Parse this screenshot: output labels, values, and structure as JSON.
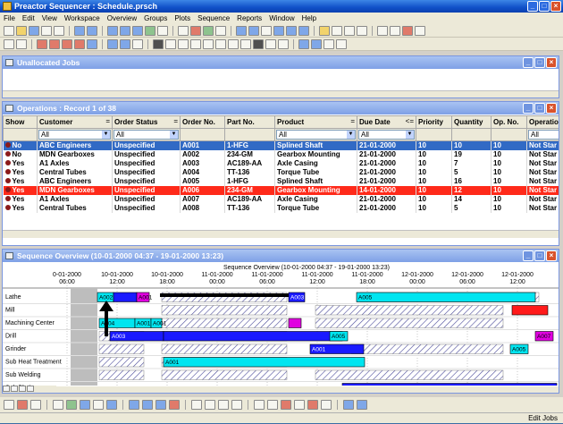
{
  "window": {
    "title": "Preactor Sequencer : Schedule.prsch"
  },
  "menu": [
    "File",
    "Edit",
    "View",
    "Workspace",
    "Overview",
    "Groups",
    "Plots",
    "Sequence",
    "Reports",
    "Window",
    "Help"
  ],
  "unallocated": {
    "title": "Unallocated Jobs"
  },
  "operations": {
    "title": "Operations : Record 1 of 38",
    "columns": [
      "Show",
      "Customer",
      "Order Status",
      "Order No.",
      "Part No.",
      "Product",
      "Due Date",
      "Priority",
      "Quantity",
      "Op. No.",
      "Operatio"
    ],
    "column_flags": {
      "customer": "=",
      "order_status": "=",
      "product": "=",
      "due_date": "<="
    },
    "filters": {
      "customer": "All",
      "order_status": "All",
      "product": "All",
      "due_date": "All",
      "operation": "All"
    },
    "rows": [
      {
        "show": "No",
        "customer": "ABC Engineers",
        "status": "Unspecified",
        "order": "A001",
        "part": "1-HFG",
        "product": "Splined Shaft",
        "due": "21-01-2000",
        "priority": "10",
        "qty": "10",
        "op": "10",
        "operation": "Not Star",
        "style": "selected"
      },
      {
        "show": "No",
        "customer": "MDN Gearboxes",
        "status": "Unspecified",
        "order": "A002",
        "part": "234-GM",
        "product": "Gearbox Mounting",
        "due": "21-01-2000",
        "priority": "10",
        "qty": "19",
        "op": "10",
        "operation": "Not Star",
        "style": ""
      },
      {
        "show": "Yes",
        "customer": "A1 Axles",
        "status": "Unspecified",
        "order": "A003",
        "part": "AC189-AA",
        "product": "Axle Casing",
        "due": "21-01-2000",
        "priority": "10",
        "qty": "7",
        "op": "10",
        "operation": "Not Star",
        "style": ""
      },
      {
        "show": "Yes",
        "customer": "Central Tubes",
        "status": "Unspecified",
        "order": "A004",
        "part": "TT-136",
        "product": "Torque Tube",
        "due": "21-01-2000",
        "priority": "10",
        "qty": "5",
        "op": "10",
        "operation": "Not Star",
        "style": ""
      },
      {
        "show": "Yes",
        "customer": "ABC Engineers",
        "status": "Unspecified",
        "order": "A005",
        "part": "1-HFG",
        "product": "Splined Shaft",
        "due": "21-01-2000",
        "priority": "10",
        "qty": "16",
        "op": "10",
        "operation": "Not Star",
        "style": ""
      },
      {
        "show": "Yes",
        "customer": "MDN Gearboxes",
        "status": "Unspecified",
        "order": "A006",
        "part": "234-GM",
        "product": "Gearbox Mounting",
        "due": "14-01-2000",
        "priority": "10",
        "qty": "12",
        "op": "10",
        "operation": "Not Star",
        "style": "late"
      },
      {
        "show": "Yes",
        "customer": "A1 Axles",
        "status": "Unspecified",
        "order": "A007",
        "part": "AC189-AA",
        "product": "Axle Casing",
        "due": "21-01-2000",
        "priority": "10",
        "qty": "14",
        "op": "10",
        "operation": "Not Star",
        "style": ""
      },
      {
        "show": "Yes",
        "customer": "Central Tubes",
        "status": "Unspecified",
        "order": "A008",
        "part": "TT-136",
        "product": "Torque Tube",
        "due": "21-01-2000",
        "priority": "10",
        "qty": "5",
        "op": "10",
        "operation": "Not Star",
        "style": ""
      }
    ]
  },
  "sequence": {
    "title": "Sequence Overview   (10-01-2000 04:37 - 19-01-2000 13:23)",
    "header": "Sequence Overview   (10-01-2000 04:37 - 19-01-2000 13:23)",
    "timeline": [
      {
        "date": "0-01-2000",
        "time": "06:00"
      },
      {
        "date": "10-01-2000",
        "time": "12:00"
      },
      {
        "date": "10-01-2000",
        "time": "18:00"
      },
      {
        "date": "11-01-2000",
        "time": "00:00"
      },
      {
        "date": "11-01-2000",
        "time": "06:00"
      },
      {
        "date": "11-01-2000",
        "time": "12:00"
      },
      {
        "date": "11-01-2000",
        "time": "18:00"
      },
      {
        "date": "12-01-2000",
        "time": "00:00"
      },
      {
        "date": "12-01-2000",
        "time": "06:00"
      },
      {
        "date": "12-01-2000",
        "time": "12:00"
      }
    ],
    "resources": [
      "Lathe",
      "Mill",
      "Machining Center",
      "Drill",
      "Grinder",
      "Sub Heat Treatment",
      "Sub Welding",
      "Sub Plating"
    ],
    "colors": {
      "cyan": "#00e5f0",
      "blue": "#1a1aff",
      "magenta": "#e000e0",
      "red": "#ff1a1a",
      "hatch": "#4a4a9a"
    },
    "jobs": {
      "lathe": [
        "A002",
        "A001",
        "A003",
        "A006",
        "A005"
      ],
      "machining": [
        "A004",
        "A001",
        "A001",
        "A003"
      ],
      "drill": [
        "A003",
        "A005",
        "A007"
      ],
      "grinder": [
        "A001",
        "A005"
      ],
      "heat": [
        "A001"
      ],
      "plating": [
        "A002"
      ]
    }
  },
  "status": {
    "right": "Edit Jobs"
  }
}
